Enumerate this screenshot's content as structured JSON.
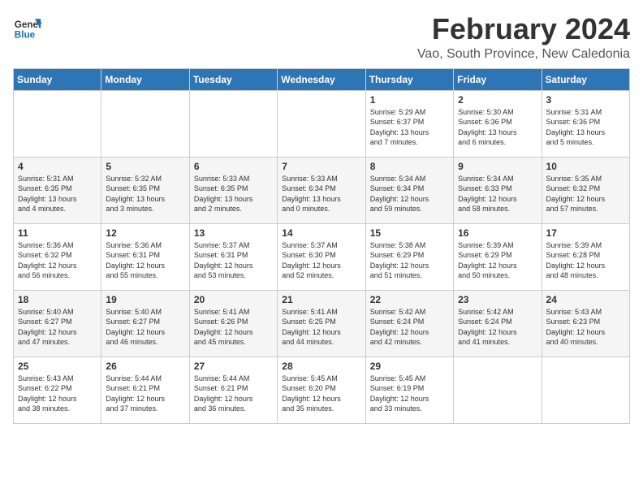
{
  "logo": {
    "line1": "General",
    "line2": "Blue"
  },
  "title": "February 2024",
  "subtitle": "Vao, South Province, New Caledonia",
  "days_of_week": [
    "Sunday",
    "Monday",
    "Tuesday",
    "Wednesday",
    "Thursday",
    "Friday",
    "Saturday"
  ],
  "weeks": [
    [
      {
        "day": "",
        "info": ""
      },
      {
        "day": "",
        "info": ""
      },
      {
        "day": "",
        "info": ""
      },
      {
        "day": "",
        "info": ""
      },
      {
        "day": "1",
        "info": "Sunrise: 5:29 AM\nSunset: 6:37 PM\nDaylight: 13 hours\nand 7 minutes."
      },
      {
        "day": "2",
        "info": "Sunrise: 5:30 AM\nSunset: 6:36 PM\nDaylight: 13 hours\nand 6 minutes."
      },
      {
        "day": "3",
        "info": "Sunrise: 5:31 AM\nSunset: 6:36 PM\nDaylight: 13 hours\nand 5 minutes."
      }
    ],
    [
      {
        "day": "4",
        "info": "Sunrise: 5:31 AM\nSunset: 6:35 PM\nDaylight: 13 hours\nand 4 minutes."
      },
      {
        "day": "5",
        "info": "Sunrise: 5:32 AM\nSunset: 6:35 PM\nDaylight: 13 hours\nand 3 minutes."
      },
      {
        "day": "6",
        "info": "Sunrise: 5:33 AM\nSunset: 6:35 PM\nDaylight: 13 hours\nand 2 minutes."
      },
      {
        "day": "7",
        "info": "Sunrise: 5:33 AM\nSunset: 6:34 PM\nDaylight: 13 hours\nand 0 minutes."
      },
      {
        "day": "8",
        "info": "Sunrise: 5:34 AM\nSunset: 6:34 PM\nDaylight: 12 hours\nand 59 minutes."
      },
      {
        "day": "9",
        "info": "Sunrise: 5:34 AM\nSunset: 6:33 PM\nDaylight: 12 hours\nand 58 minutes."
      },
      {
        "day": "10",
        "info": "Sunrise: 5:35 AM\nSunset: 6:32 PM\nDaylight: 12 hours\nand 57 minutes."
      }
    ],
    [
      {
        "day": "11",
        "info": "Sunrise: 5:36 AM\nSunset: 6:32 PM\nDaylight: 12 hours\nand 56 minutes."
      },
      {
        "day": "12",
        "info": "Sunrise: 5:36 AM\nSunset: 6:31 PM\nDaylight: 12 hours\nand 55 minutes."
      },
      {
        "day": "13",
        "info": "Sunrise: 5:37 AM\nSunset: 6:31 PM\nDaylight: 12 hours\nand 53 minutes."
      },
      {
        "day": "14",
        "info": "Sunrise: 5:37 AM\nSunset: 6:30 PM\nDaylight: 12 hours\nand 52 minutes."
      },
      {
        "day": "15",
        "info": "Sunrise: 5:38 AM\nSunset: 6:29 PM\nDaylight: 12 hours\nand 51 minutes."
      },
      {
        "day": "16",
        "info": "Sunrise: 5:39 AM\nSunset: 6:29 PM\nDaylight: 12 hours\nand 50 minutes."
      },
      {
        "day": "17",
        "info": "Sunrise: 5:39 AM\nSunset: 6:28 PM\nDaylight: 12 hours\nand 48 minutes."
      }
    ],
    [
      {
        "day": "18",
        "info": "Sunrise: 5:40 AM\nSunset: 6:27 PM\nDaylight: 12 hours\nand 47 minutes."
      },
      {
        "day": "19",
        "info": "Sunrise: 5:40 AM\nSunset: 6:27 PM\nDaylight: 12 hours\nand 46 minutes."
      },
      {
        "day": "20",
        "info": "Sunrise: 5:41 AM\nSunset: 6:26 PM\nDaylight: 12 hours\nand 45 minutes."
      },
      {
        "day": "21",
        "info": "Sunrise: 5:41 AM\nSunset: 6:25 PM\nDaylight: 12 hours\nand 44 minutes."
      },
      {
        "day": "22",
        "info": "Sunrise: 5:42 AM\nSunset: 6:24 PM\nDaylight: 12 hours\nand 42 minutes."
      },
      {
        "day": "23",
        "info": "Sunrise: 5:42 AM\nSunset: 6:24 PM\nDaylight: 12 hours\nand 41 minutes."
      },
      {
        "day": "24",
        "info": "Sunrise: 5:43 AM\nSunset: 6:23 PM\nDaylight: 12 hours\nand 40 minutes."
      }
    ],
    [
      {
        "day": "25",
        "info": "Sunrise: 5:43 AM\nSunset: 6:22 PM\nDaylight: 12 hours\nand 38 minutes."
      },
      {
        "day": "26",
        "info": "Sunrise: 5:44 AM\nSunset: 6:21 PM\nDaylight: 12 hours\nand 37 minutes."
      },
      {
        "day": "27",
        "info": "Sunrise: 5:44 AM\nSunset: 6:21 PM\nDaylight: 12 hours\nand 36 minutes."
      },
      {
        "day": "28",
        "info": "Sunrise: 5:45 AM\nSunset: 6:20 PM\nDaylight: 12 hours\nand 35 minutes."
      },
      {
        "day": "29",
        "info": "Sunrise: 5:45 AM\nSunset: 6:19 PM\nDaylight: 12 hours\nand 33 minutes."
      },
      {
        "day": "",
        "info": ""
      },
      {
        "day": "",
        "info": ""
      }
    ]
  ]
}
